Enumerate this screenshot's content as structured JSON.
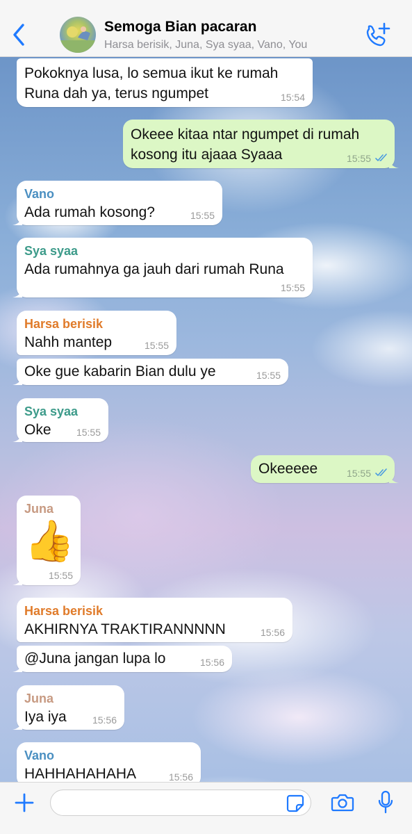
{
  "header": {
    "title": "Semoga Bian pacaran",
    "members": "Harsa berisik, Juna, Sya syaa, Vano, You"
  },
  "colors": {
    "accent": "#1f7aff",
    "outgoing_bubble": "#dcf7c5",
    "incoming_bubble": "#ffffff",
    "sender_vano": "#4a8fc1",
    "sender_sya": "#3d9b8a",
    "sender_harsa": "#e07b2a",
    "sender_juna": "#c79a82",
    "read_check": "#4a9be0"
  },
  "messages": [
    {
      "direction": "in",
      "sender": "",
      "text": "Pokoknya lusa, lo semua ikut ke rumah Runa dah ya, terus ngumpet",
      "time": "15:54"
    },
    {
      "direction": "out",
      "text": "Okeee kitaa ntar ngumpet di rumah kosong itu ajaaa Syaaa",
      "time": "15:55",
      "status": "read"
    },
    {
      "direction": "in",
      "sender": "Vano",
      "text": "Ada rumah kosong?",
      "time": "15:55"
    },
    {
      "direction": "in",
      "sender": "Sya syaa",
      "text": "Ada rumahnya ga jauh dari rumah Runa",
      "time": "15:55"
    },
    {
      "direction": "in",
      "sender": "Harsa berisik",
      "text": "Nahh mantep",
      "time": "15:55"
    },
    {
      "direction": "in",
      "sender": "",
      "text": "Oke gue kabarin Bian dulu ye",
      "time": "15:55"
    },
    {
      "direction": "in",
      "sender": "Sya syaa",
      "text": "Oke",
      "time": "15:55"
    },
    {
      "direction": "out",
      "text": "Okeeeee",
      "time": "15:55",
      "status": "read"
    },
    {
      "direction": "in",
      "sender": "Juna",
      "text": "👍",
      "time": "15:55",
      "type": "sticker",
      "icon": "thumbs-up-icon"
    },
    {
      "direction": "in",
      "sender": "Harsa berisik",
      "text": "AKHIRNYA TRAKTIRANNNNN",
      "time": "15:56"
    },
    {
      "direction": "in",
      "sender": "",
      "text": "@Juna jangan lupa lo",
      "time": "15:56"
    },
    {
      "direction": "in",
      "sender": "Juna",
      "text": "Iya iya",
      "time": "15:56"
    },
    {
      "direction": "in",
      "sender": "Vano",
      "text": "HAHHAHAHAHA",
      "time": "15:56"
    }
  ],
  "input": {
    "placeholder": ""
  },
  "icons": [
    "back-chevron-icon",
    "add-call-icon",
    "plus-icon",
    "sticker-icon",
    "camera-icon",
    "microphone-icon",
    "double-check-icon"
  ]
}
